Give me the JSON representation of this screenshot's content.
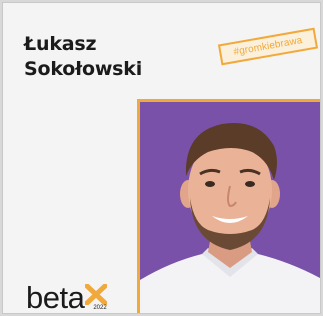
{
  "person": {
    "first_name": "Łukasz",
    "last_name": "Sokołowski"
  },
  "tag": {
    "label": "#gromkiebrawa"
  },
  "logo": {
    "word": "beta",
    "year": "2022",
    "accent_color": "#f2a93b"
  },
  "photo": {
    "background_color": "#7a51a8"
  },
  "colors": {
    "frame": "#f2a93b",
    "text": "#1b1b1b",
    "card": "#f4f4f4"
  }
}
